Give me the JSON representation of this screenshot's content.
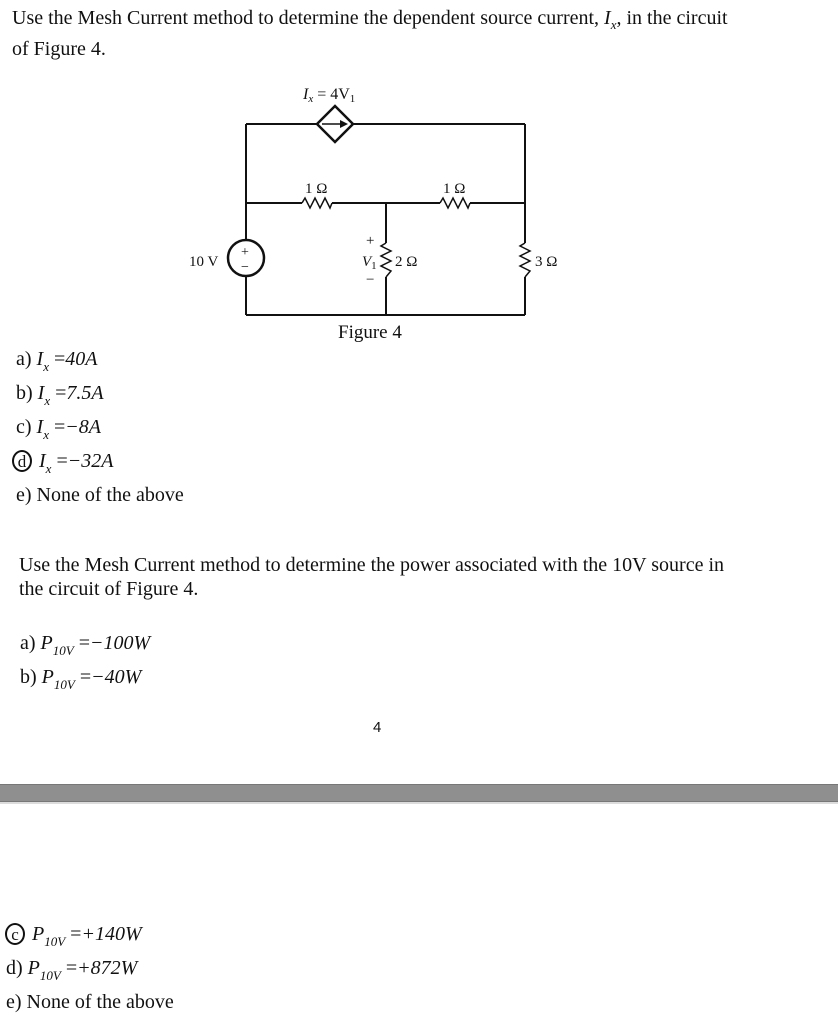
{
  "question1": {
    "prompt_before": "Use the Mesh Current method to determine the dependent source current, ",
    "prompt_var": "I",
    "prompt_var_sub": "x",
    "prompt_after_line1": ", in the circuit",
    "prompt_line2": "of Figure 4.",
    "options": [
      {
        "letter": "a)",
        "var": "I",
        "sub": "x",
        "eq": "=",
        "value": "40A",
        "circled": false
      },
      {
        "letter": "b)",
        "var": "I",
        "sub": "x",
        "eq": "=",
        "value": "7.5A",
        "circled": false
      },
      {
        "letter": "c)",
        "var": "I",
        "sub": "x",
        "eq": "=",
        "value": "−8A",
        "circled": false
      },
      {
        "letter": "d",
        "var": "I",
        "sub": "x",
        "eq": "=",
        "value": "−32A",
        "circled": true
      },
      {
        "letter": "e)",
        "text": "None of the above",
        "circled": false
      }
    ]
  },
  "figure": {
    "caption": "Figure 4",
    "dependent_source_label": "I",
    "dependent_source_label_sub": "x",
    "dependent_source_expr": " = 4V",
    "dependent_source_expr_sub": "1",
    "voltage_source_label": "10 V",
    "voltage_source_plus": "+",
    "voltage_source_minus": "−",
    "r_top_left": "1 Ω",
    "r_top_right": "1 Ω",
    "r_middle": "2 Ω",
    "r_right": "3 Ω",
    "v1_label": "V",
    "v1_sub": "1",
    "v1_plus": "+",
    "v1_minus": "−"
  },
  "question2": {
    "prompt_line1": "Use the Mesh Current method to determine the power associated with the 10V source in",
    "prompt_line2": "the circuit of Figure 4.",
    "options": [
      {
        "letter": "a)",
        "var": "P",
        "sub": "10V",
        "eq": "=",
        "value": "−100W",
        "circled": false
      },
      {
        "letter": "b)",
        "var": "P",
        "sub": "10V",
        "eq": "=",
        "value": "−40W",
        "circled": false
      },
      {
        "letter": "c",
        "var": "P",
        "sub": "10V",
        "eq": "=",
        "value": "+140W",
        "circled": true
      },
      {
        "letter": "d)",
        "var": "P",
        "sub": "10V",
        "eq": "=",
        "value": "+872W",
        "circled": false
      },
      {
        "letter": "e)",
        "text": "None of the above",
        "circled": false
      }
    ]
  },
  "page_number": "4"
}
